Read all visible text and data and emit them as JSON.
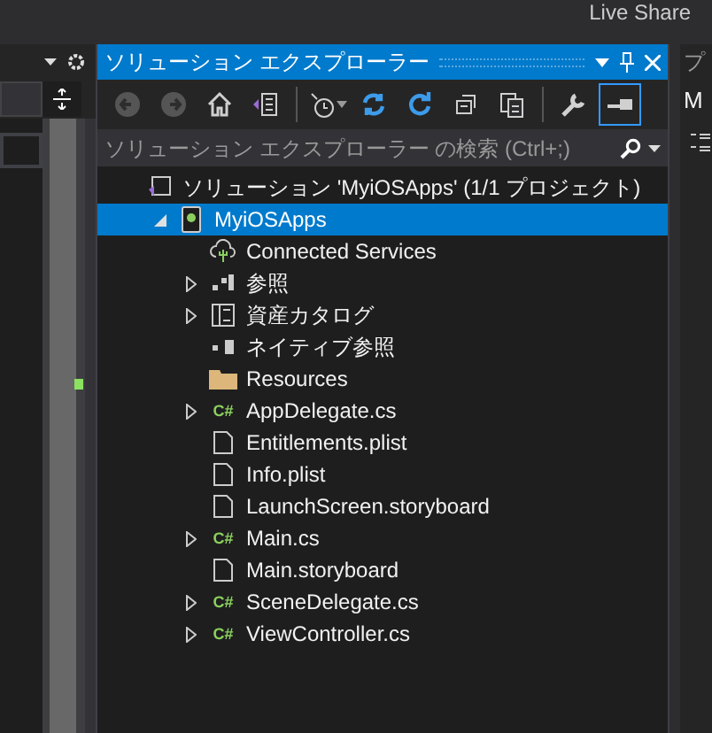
{
  "top_bar": {
    "live_share": "Live Share"
  },
  "explorer": {
    "title": "ソリューション エクスプローラー",
    "search": {
      "placeholder": "ソリューション エクスプローラー の検索 (Ctrl+;)"
    },
    "toolbar": [
      {
        "kind": "back",
        "disabled": true
      },
      {
        "kind": "forward",
        "disabled": true
      },
      {
        "kind": "home",
        "disabled": false
      },
      {
        "kind": "vsswitch",
        "disabled": false
      },
      {
        "kind": "sep"
      },
      {
        "kind": "history",
        "disabled": false
      },
      {
        "kind": "sync",
        "disabled": false
      },
      {
        "kind": "refresh",
        "disabled": false
      },
      {
        "kind": "collapse",
        "disabled": false
      },
      {
        "kind": "copy",
        "disabled": false
      },
      {
        "kind": "sep"
      },
      {
        "kind": "wrench",
        "disabled": false
      },
      {
        "kind": "preview",
        "disabled": false,
        "selected": true
      }
    ],
    "tree": [
      {
        "kind": "solution",
        "label": "ソリューション 'MyiOSApps' (1/1 プロジェクト)",
        "expander": false,
        "selected": false,
        "children": [
          {
            "kind": "project",
            "label": "MyiOSApps",
            "expander": true,
            "expanded": true,
            "selected": true,
            "children": [
              {
                "kind": "connected",
                "label": "Connected Services",
                "expander": false,
                "expanded": false,
                "selected": false
              },
              {
                "kind": "references",
                "label": "参照",
                "expander": true,
                "expanded": false,
                "selected": false
              },
              {
                "kind": "assets",
                "label": "資産カタログ",
                "expander": true,
                "expanded": false,
                "selected": false
              },
              {
                "kind": "native",
                "label": "ネイティブ参照",
                "expander": false,
                "expanded": false,
                "selected": false
              },
              {
                "kind": "folder",
                "label": "Resources",
                "expander": false,
                "expanded": false,
                "selected": false
              },
              {
                "kind": "csharp",
                "icon": "C#",
                "label": "AppDelegate.cs",
                "expander": true,
                "expanded": false,
                "selected": false
              },
              {
                "kind": "file",
                "label": "Entitlements.plist",
                "expander": false,
                "expanded": false,
                "selected": false
              },
              {
                "kind": "file",
                "label": "Info.plist",
                "expander": false,
                "expanded": false,
                "selected": false
              },
              {
                "kind": "file",
                "label": "LaunchScreen.storyboard",
                "expander": false,
                "expanded": false,
                "selected": false
              },
              {
                "kind": "csharp",
                "icon": "C#",
                "label": "Main.cs",
                "expander": true,
                "expanded": false,
                "selected": false
              },
              {
                "kind": "file",
                "label": "Main.storyboard",
                "expander": false,
                "expanded": false,
                "selected": false
              },
              {
                "kind": "csharp",
                "icon": "C#",
                "label": "SceneDelegate.cs",
                "expander": true,
                "expanded": false,
                "selected": false
              },
              {
                "kind": "csharp",
                "icon": "C#",
                "label": "ViewController.cs",
                "expander": true,
                "expanded": false,
                "selected": false
              }
            ]
          }
        ]
      }
    ]
  },
  "right_panel": {
    "title": "プ",
    "field": "M"
  }
}
